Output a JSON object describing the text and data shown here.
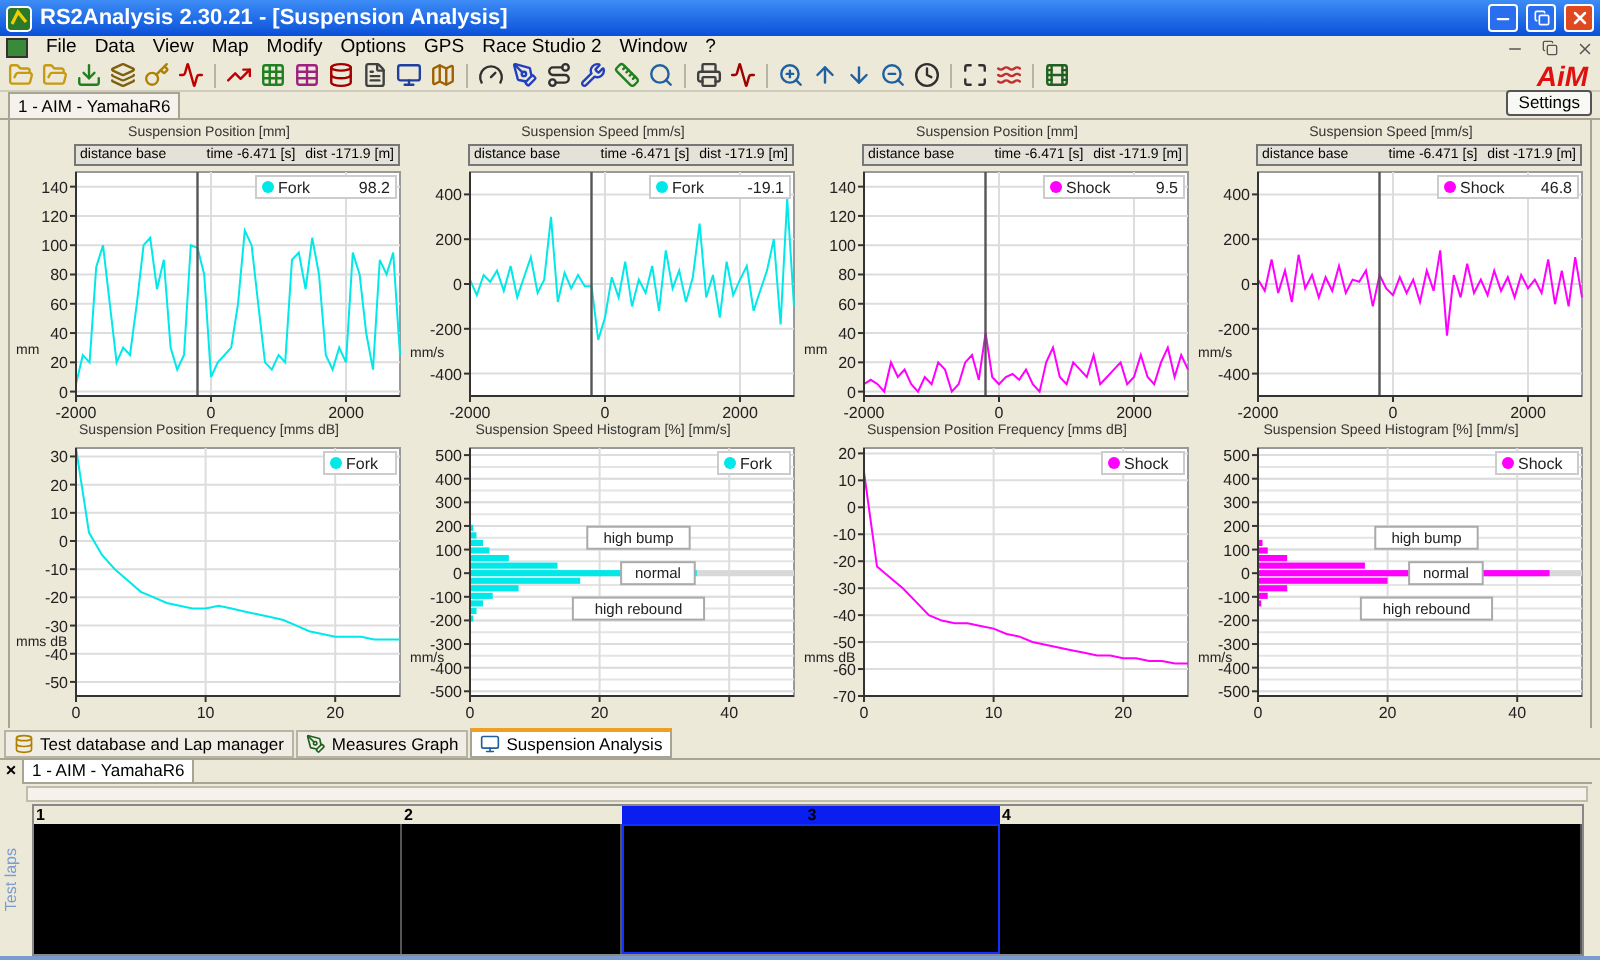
{
  "window": {
    "title": "RS2Analysis 2.30.21 - [Suspension Analysis]"
  },
  "menu": [
    "File",
    "Data",
    "View",
    "Map",
    "Modify",
    "Options",
    "GPS",
    "Race Studio 2",
    "Window",
    "?"
  ],
  "logo": "AiM",
  "document_tab": "1 - AIM - YamahaR6",
  "settings_button": "Settings",
  "charts": [
    {
      "title": "Suspension Position [mm]",
      "header": {
        "base": "distance base",
        "time": "time -6.471 [s]",
        "dist": "dist -171.9 [m]"
      },
      "legend_value": "98.2",
      "chart_data": {
        "type": "line",
        "ylabel": "mm",
        "xlim": [
          -2000,
          2800
        ],
        "ylim": [
          -3,
          150
        ],
        "xticks": [
          -2000,
          0,
          2000
        ],
        "yticks": [
          0,
          20,
          40,
          60,
          80,
          100,
          120,
          140
        ],
        "x": [
          -2000,
          -1900,
          -1800,
          -1700,
          -1600,
          -1500,
          -1400,
          -1300,
          -1200,
          -1100,
          -1000,
          -900,
          -800,
          -700,
          -600,
          -500,
          -400,
          -300,
          -200,
          -100,
          0,
          100,
          200,
          300,
          400,
          500,
          600,
          700,
          800,
          900,
          1000,
          1100,
          1200,
          1300,
          1400,
          1500,
          1600,
          1700,
          1800,
          1900,
          2000,
          2100,
          2200,
          2300,
          2400,
          2500,
          2600,
          2700,
          2800
        ],
        "series": [
          {
            "name": "Fork",
            "color": "#00e8e8",
            "values": [
              5,
              25,
              20,
              85,
              100,
              60,
              20,
              30,
              25,
              60,
              100,
              105,
              70,
              90,
              30,
              15,
              25,
              100,
              98,
              80,
              10,
              20,
              25,
              30,
              60,
              110,
              100,
              60,
              20,
              15,
              25,
              20,
              90,
              95,
              70,
              105,
              80,
              25,
              15,
              30,
              20,
              95,
              80,
              40,
              15,
              90,
              80,
              95,
              25
            ]
          }
        ],
        "grid": true,
        "ref_lines": [
          {
            "axis": "x",
            "value": -200
          }
        ]
      }
    },
    {
      "title": "Suspension Speed [mm/s]",
      "header": {
        "base": "distance base",
        "time": "time -6.471 [s]",
        "dist": "dist -171.9 [m]"
      },
      "legend_value": "-19.1",
      "chart_data": {
        "type": "line",
        "ylabel": "mm/s",
        "xlim": [
          -2000,
          2800
        ],
        "ylim": [
          -500,
          500
        ],
        "xticks": [
          -2000,
          0,
          2000
        ],
        "yticks": [
          -400,
          -200,
          0,
          200,
          400
        ],
        "x": [
          -2000,
          -1900,
          -1800,
          -1700,
          -1600,
          -1500,
          -1400,
          -1300,
          -1200,
          -1100,
          -1000,
          -900,
          -800,
          -700,
          -600,
          -500,
          -400,
          -300,
          -200,
          -100,
          0,
          100,
          200,
          300,
          400,
          500,
          600,
          700,
          800,
          900,
          1000,
          1100,
          1200,
          1300,
          1400,
          1500,
          1600,
          1700,
          1800,
          1900,
          2000,
          2100,
          2200,
          2300,
          2400,
          2500,
          2600,
          2700,
          2800
        ],
        "series": [
          {
            "name": "Fork",
            "color": "#00e8e8",
            "values": [
              20,
              -50,
              40,
              10,
              60,
              -30,
              80,
              -60,
              30,
              120,
              -40,
              20,
              300,
              -80,
              50,
              -20,
              40,
              -10,
              -10,
              -250,
              -150,
              30,
              -60,
              100,
              -100,
              20,
              -40,
              80,
              -120,
              150,
              -20,
              60,
              -80,
              30,
              270,
              -60,
              40,
              -150,
              100,
              -50,
              20,
              80,
              -120,
              -30,
              60,
              200,
              -180,
              380,
              -100
            ]
          }
        ],
        "grid": true,
        "ref_lines": [
          {
            "axis": "x",
            "value": -200
          }
        ]
      }
    },
    {
      "title": "Suspension Position [mm]",
      "header": {
        "base": "distance base",
        "time": "time -6.471 [s]",
        "dist": "dist -171.9 [m]"
      },
      "legend_value": "9.5",
      "chart_data": {
        "type": "line",
        "ylabel": "mm",
        "xlim": [
          -2000,
          2800
        ],
        "ylim": [
          -3,
          150
        ],
        "xticks": [
          -2000,
          0,
          2000
        ],
        "yticks": [
          0,
          20,
          40,
          60,
          80,
          100,
          120,
          140
        ],
        "x": [
          -2000,
          -1900,
          -1800,
          -1700,
          -1600,
          -1500,
          -1400,
          -1300,
          -1200,
          -1100,
          -1000,
          -900,
          -800,
          -700,
          -600,
          -500,
          -400,
          -300,
          -200,
          -100,
          0,
          100,
          200,
          300,
          400,
          500,
          600,
          700,
          800,
          900,
          1000,
          1100,
          1200,
          1300,
          1400,
          1500,
          1600,
          1700,
          1800,
          1900,
          2000,
          2100,
          2200,
          2300,
          2400,
          2500,
          2600,
          2700,
          2800
        ],
        "series": [
          {
            "name": "Shock",
            "color": "#ff00ff",
            "values": [
              5,
              8,
              5,
              0,
              20,
              10,
              15,
              5,
              0,
              10,
              5,
              20,
              15,
              0,
              5,
              20,
              25,
              8,
              40,
              10,
              5,
              10,
              12,
              8,
              15,
              5,
              0,
              20,
              30,
              10,
              5,
              20,
              15,
              10,
              25,
              5,
              10,
              15,
              20,
              5,
              10,
              25,
              10,
              5,
              20,
              30,
              10,
              25,
              15
            ]
          }
        ],
        "grid": true,
        "ref_lines": [
          {
            "axis": "x",
            "value": -200
          }
        ]
      }
    },
    {
      "title": "Suspension Speed [mm/s]",
      "header": {
        "base": "distance base",
        "time": "time -6.471 [s]",
        "dist": "dist -171.9 [m]"
      },
      "legend_value": "46.8",
      "chart_data": {
        "type": "line",
        "ylabel": "mm/s",
        "xlim": [
          -2000,
          2800
        ],
        "ylim": [
          -500,
          500
        ],
        "xticks": [
          -2000,
          0,
          2000
        ],
        "yticks": [
          -400,
          -200,
          0,
          200,
          400
        ],
        "x": [
          -2000,
          -1900,
          -1800,
          -1700,
          -1600,
          -1500,
          -1400,
          -1300,
          -1200,
          -1100,
          -1000,
          -900,
          -800,
          -700,
          -600,
          -500,
          -400,
          -300,
          -200,
          -100,
          0,
          100,
          200,
          300,
          400,
          500,
          600,
          700,
          800,
          900,
          1000,
          1100,
          1200,
          1300,
          1400,
          1500,
          1600,
          1700,
          1800,
          1900,
          2000,
          2100,
          2200,
          2300,
          2400,
          2500,
          2600,
          2700,
          2800
        ],
        "series": [
          {
            "name": "Shock",
            "color": "#ff00ff",
            "values": [
              20,
              -30,
              110,
              -40,
              60,
              -80,
              130,
              -20,
              40,
              -60,
              30,
              -30,
              80,
              -40,
              20,
              10,
              60,
              -100,
              40,
              -20,
              -50,
              30,
              -40,
              20,
              -80,
              60,
              -30,
              150,
              -230,
              40,
              -60,
              90,
              -40,
              20,
              -50,
              60,
              -30,
              30,
              -60,
              40,
              -20,
              20,
              -40,
              110,
              -90,
              60,
              -100,
              120,
              -60
            ]
          }
        ],
        "grid": true,
        "ref_lines": [
          {
            "axis": "x",
            "value": -200
          }
        ]
      }
    },
    {
      "title": "Suspension Position Frequency [mms dB]",
      "chart_data": {
        "type": "line",
        "ylabel": "mms dB",
        "xlim": [
          0,
          25
        ],
        "ylim": [
          -55,
          33
        ],
        "xticks": [
          0,
          10,
          20
        ],
        "yticks": [
          -50,
          -40,
          -30,
          -20,
          -10,
          0,
          10,
          20,
          30
        ],
        "x": [
          0,
          1,
          2,
          3,
          4,
          5,
          6,
          7,
          8,
          9,
          10,
          11,
          12,
          13,
          14,
          15,
          16,
          17,
          18,
          19,
          20,
          21,
          22,
          23,
          24,
          25
        ],
        "grid": true,
        "series": [
          {
            "name": "Fork",
            "color": "#00e8e8",
            "values": [
              33,
              3,
              -5,
              -10,
              -14,
              -18,
              -20,
              -22,
              -23,
              -24,
              -24,
              -23,
              -24,
              -25,
              -26,
              -27,
              -28,
              -30,
              -32,
              -33,
              -34,
              -34,
              -34,
              -35,
              -35,
              -35
            ]
          }
        ]
      }
    },
    {
      "title": "Suspension Speed Histogram [%] [mm/s]",
      "chart_data": {
        "type": "bar",
        "orientation": "horizontal",
        "ylabel": "mm/s",
        "xlim": [
          0,
          50
        ],
        "ylim": [
          -520,
          530
        ],
        "xticks": [
          0,
          20,
          40
        ],
        "yticks": [
          -500,
          -400,
          -300,
          -200,
          -100,
          0,
          100,
          200,
          300,
          400,
          500
        ],
        "x": [
          192,
          160,
          128,
          96,
          64,
          32,
          0,
          -32,
          -64,
          -96,
          -128,
          -160,
          -192
        ],
        "grid": true,
        "series": [
          {
            "name": "Fork",
            "color": "#00e8e8",
            "values": [
              0.5,
              1,
              2,
              3,
              6,
              13.5,
              35,
              17,
              7.5,
              3.5,
              2,
              1,
              0.5
            ]
          }
        ],
        "annotations": [
          "high bump",
          "normal",
          "high rebound"
        ]
      }
    },
    {
      "title": "Suspension Position Frequency [mms dB]",
      "chart_data": {
        "type": "line",
        "ylabel": "mms dB",
        "xlim": [
          0,
          25
        ],
        "ylim": [
          -70,
          22
        ],
        "xticks": [
          0,
          10,
          20
        ],
        "yticks": [
          -70,
          -60,
          -50,
          -40,
          -30,
          -20,
          -10,
          0,
          10,
          20
        ],
        "x": [
          0,
          1,
          2,
          3,
          4,
          5,
          6,
          7,
          8,
          9,
          10,
          11,
          12,
          13,
          14,
          15,
          16,
          17,
          18,
          19,
          20,
          21,
          22,
          23,
          24,
          25
        ],
        "grid": true,
        "series": [
          {
            "name": "Shock",
            "color": "#ff00ff",
            "values": [
              13,
              -22,
              -26,
              -30,
              -35,
              -40,
              -42,
              -43,
              -43,
              -44,
              -45,
              -47,
              -48,
              -50,
              -51,
              -52,
              -53,
              -54,
              -55,
              -55,
              -56,
              -56,
              -57,
              -57,
              -58,
              -58
            ]
          }
        ]
      }
    },
    {
      "title": "Suspension Speed Histogram [%] [mm/s]",
      "chart_data": {
        "type": "bar",
        "orientation": "horizontal",
        "ylabel": "mm/s",
        "xlim": [
          0,
          50
        ],
        "ylim": [
          -520,
          530
        ],
        "xticks": [
          0,
          20,
          40
        ],
        "yticks": [
          -500,
          -400,
          -300,
          -200,
          -100,
          0,
          100,
          200,
          300,
          400,
          500
        ],
        "x": [
          192,
          160,
          128,
          96,
          64,
          32,
          0,
          -32,
          -64,
          -96,
          -128,
          -160,
          -192
        ],
        "grid": true,
        "series": [
          {
            "name": "Shock",
            "color": "#ff00ff",
            "values": [
              0,
              0,
              0.7,
              1.5,
              4.5,
              16.5,
              45,
              20,
              4.5,
              1.5,
              0.5,
              0,
              0
            ]
          }
        ],
        "annotations": [
          "high bump",
          "normal",
          "high rebound"
        ]
      }
    }
  ],
  "bottom_tabs": [
    {
      "label": "Test database and Lap manager",
      "selected": false
    },
    {
      "label": "Measures Graph",
      "selected": false
    },
    {
      "label": "Suspension Analysis",
      "selected": true
    }
  ],
  "lap_panel": {
    "close": "×",
    "side_label": "Test laps",
    "tab": "1 - AIM - YamahaR6",
    "laps": [
      {
        "label": "1",
        "selected": false
      },
      {
        "label": "2",
        "selected": false
      },
      {
        "label": "3",
        "selected": true
      },
      {
        "label": "4",
        "selected": false
      }
    ]
  }
}
